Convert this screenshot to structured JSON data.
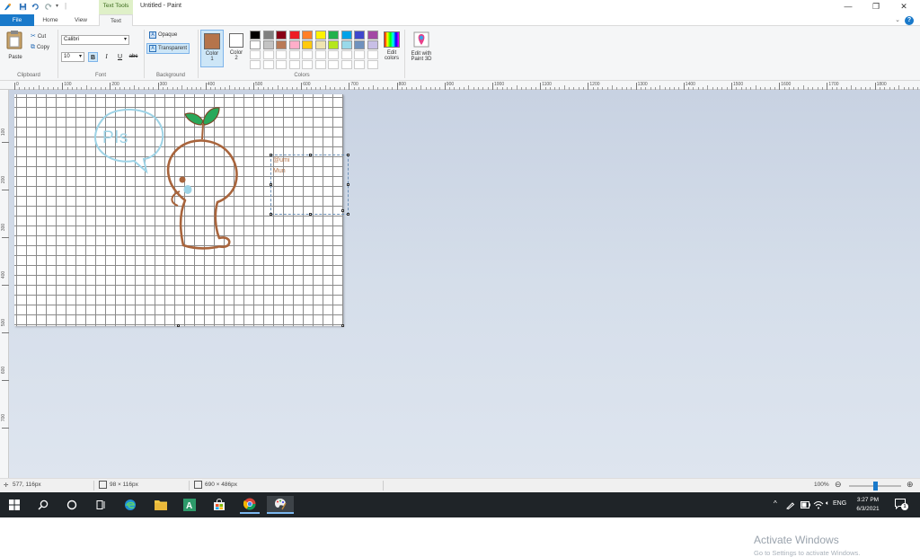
{
  "titlebar": {
    "contextual_tab": "Text Tools",
    "window_title": "Untitled - Paint"
  },
  "tabs": {
    "file": "File",
    "home": "Home",
    "view": "View",
    "text": "Text",
    "help": "?"
  },
  "clipboard": {
    "paste": "Paste",
    "cut": "Cut",
    "copy": "Copy",
    "label": "Clipboard"
  },
  "font": {
    "family": "Calibri",
    "size": "10",
    "bold": "B",
    "italic": "I",
    "underline": "U",
    "strikethrough": "abc",
    "label": "Font"
  },
  "background": {
    "opaque": "Opaque",
    "transparent": "Transparent",
    "label": "Background"
  },
  "colors": {
    "color1_label": "Color",
    "color1_num": "1",
    "color2_label": "Color",
    "color2_num": "2",
    "edit_colors_1": "Edit",
    "edit_colors_2": "colors",
    "edit_with_1": "Edit with",
    "edit_with_2": "Paint 3D",
    "label": "Colors",
    "color1_value": "#b5744b",
    "color2_value": "#ffffff",
    "palette_row1": [
      "#000000",
      "#7f7f7f",
      "#880015",
      "#ed1c24",
      "#ff7f27",
      "#fff200",
      "#22b14c",
      "#00a2e8",
      "#3f48cc",
      "#a349a4"
    ],
    "palette_row2": [
      "#ffffff",
      "#c3c3c3",
      "#b97a57",
      "#ffaec9",
      "#ffc90e",
      "#efe4b0",
      "#b5e61d",
      "#99d9ea",
      "#7092be",
      "#c8bfe7"
    ]
  },
  "ruler": {
    "h_ticks": [
      "0",
      "100",
      "200",
      "300",
      "400",
      "500",
      "600",
      "700",
      "800",
      "900",
      "1000",
      "1100",
      "1200",
      "1300",
      "1400",
      "1500",
      "1600",
      "1700",
      "1800"
    ],
    "v_ticks": [
      "100",
      "200",
      "300",
      "400",
      "500",
      "600",
      "700"
    ]
  },
  "canvas": {
    "speech_text": "Pls",
    "text_line_1": "@umi",
    "text_line_2": "Mun"
  },
  "watermark": {
    "title": "Activate Windows",
    "subtitle": "Go to Settings to activate Windows."
  },
  "statusbar": {
    "cursor_pos": "577, 116px",
    "selection_size": "98 × 116px",
    "image_size": "690 × 486px",
    "zoom": "100%",
    "zoom_fraction": 0.5
  },
  "taskbar": {
    "language": "ENG",
    "time": "3:27 PM",
    "date": "6/3/2021",
    "notification_count": "1"
  }
}
